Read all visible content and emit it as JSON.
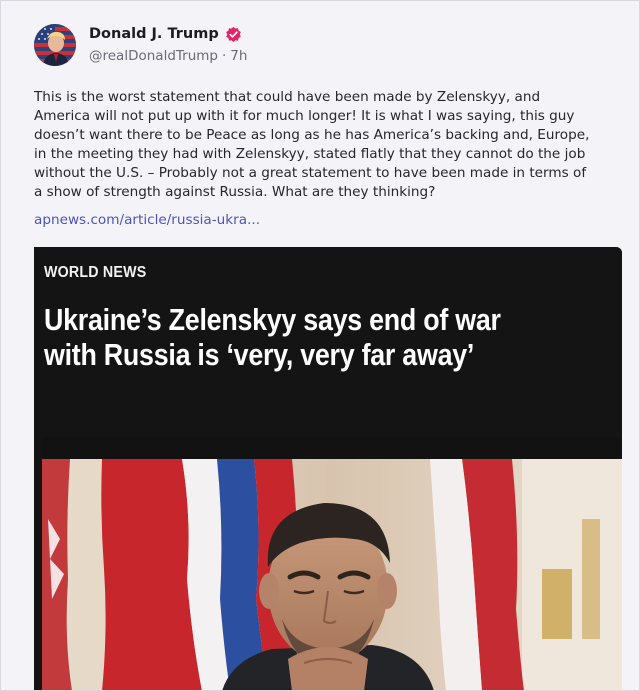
{
  "author": {
    "display_name": "Donald J. Trump",
    "handle": "@realDonaldTrump",
    "separator": "·",
    "timestamp": "7h",
    "avatar_icon": "avatar-flag-portrait",
    "verified_icon": "verified-badge-icon",
    "verified_color": "#e0266a"
  },
  "post": {
    "lines": [
      "This is the worst statement that could have been made by Zelenskyy, and",
      "America will not put up with it for much longer! It is what I was saying, this guy",
      "doesn’t want there to be Peace as long as he has America’s backing and, Europe,",
      "in the meeting they had with Zelenskyy, stated flatly that they cannot do the job",
      "without the U.S. – Probably not a great statement to have been made in terms of",
      "a show of strength against Russia. What are they thinking?"
    ],
    "link_text": "apnews.com/article/russia-ukra...",
    "link_color": "#4b55b8"
  },
  "link_card": {
    "kicker": "WORLD NEWS",
    "headline_lines": [
      "Ukraine’s Zelenskyy says end of war",
      "with Russia is ‘very, very far away’"
    ],
    "background_color": "#141414",
    "image_description_icon": "news-photo"
  }
}
